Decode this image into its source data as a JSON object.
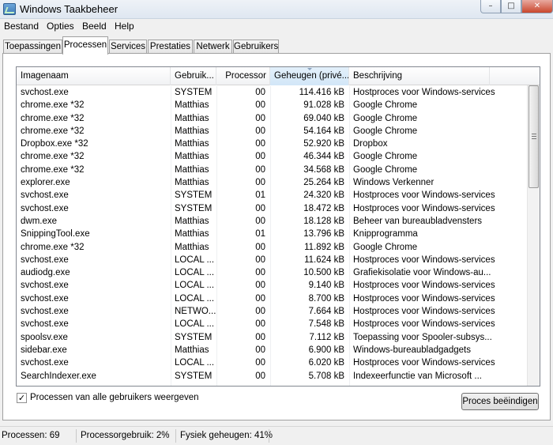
{
  "window": {
    "title": "Windows Taakbeheer"
  },
  "menu": [
    "Bestand",
    "Opties",
    "Beeld",
    "Help"
  ],
  "tabs": [
    "Toepassingen",
    "Processen",
    "Services",
    "Prestaties",
    "Netwerk",
    "Gebruikers"
  ],
  "active_tab": "Processen",
  "columns": {
    "name": "Imagenaam",
    "user": "Gebruik...",
    "cpu": "Processor",
    "mem": "Geheugen (privé...",
    "desc": "Beschrijving"
  },
  "sorted_column": "mem",
  "processes": [
    {
      "name": "svchost.exe",
      "user": "SYSTEM",
      "cpu": "00",
      "mem": "114.416 kB",
      "desc": "Hostproces voor Windows-services"
    },
    {
      "name": "chrome.exe *32",
      "user": "Matthias",
      "cpu": "00",
      "mem": "91.028 kB",
      "desc": "Google Chrome"
    },
    {
      "name": "chrome.exe *32",
      "user": "Matthias",
      "cpu": "00",
      "mem": "69.040 kB",
      "desc": "Google Chrome"
    },
    {
      "name": "chrome.exe *32",
      "user": "Matthias",
      "cpu": "00",
      "mem": "54.164 kB",
      "desc": "Google Chrome"
    },
    {
      "name": "Dropbox.exe *32",
      "user": "Matthias",
      "cpu": "00",
      "mem": "52.920 kB",
      "desc": "Dropbox"
    },
    {
      "name": "chrome.exe *32",
      "user": "Matthias",
      "cpu": "00",
      "mem": "46.344 kB",
      "desc": "Google Chrome"
    },
    {
      "name": "chrome.exe *32",
      "user": "Matthias",
      "cpu": "00",
      "mem": "34.568 kB",
      "desc": "Google Chrome"
    },
    {
      "name": "explorer.exe",
      "user": "Matthias",
      "cpu": "00",
      "mem": "25.264 kB",
      "desc": "Windows Verkenner"
    },
    {
      "name": "svchost.exe",
      "user": "SYSTEM",
      "cpu": "01",
      "mem": "24.320 kB",
      "desc": "Hostproces voor Windows-services"
    },
    {
      "name": "svchost.exe",
      "user": "SYSTEM",
      "cpu": "00",
      "mem": "18.472 kB",
      "desc": "Hostproces voor Windows-services"
    },
    {
      "name": "dwm.exe",
      "user": "Matthias",
      "cpu": "00",
      "mem": "18.128 kB",
      "desc": "Beheer van bureaubladvensters"
    },
    {
      "name": "SnippingTool.exe",
      "user": "Matthias",
      "cpu": "01",
      "mem": "13.796 kB",
      "desc": "Knipprogramma"
    },
    {
      "name": "chrome.exe *32",
      "user": "Matthias",
      "cpu": "00",
      "mem": "11.892 kB",
      "desc": "Google Chrome"
    },
    {
      "name": "svchost.exe",
      "user": "LOCAL ...",
      "cpu": "00",
      "mem": "11.624 kB",
      "desc": "Hostproces voor Windows-services"
    },
    {
      "name": "audiodg.exe",
      "user": "LOCAL ...",
      "cpu": "00",
      "mem": "10.500 kB",
      "desc": "Grafiekisolatie voor Windows-au..."
    },
    {
      "name": "svchost.exe",
      "user": "LOCAL ...",
      "cpu": "00",
      "mem": "9.140 kB",
      "desc": "Hostproces voor Windows-services"
    },
    {
      "name": "svchost.exe",
      "user": "LOCAL ...",
      "cpu": "00",
      "mem": "8.700 kB",
      "desc": "Hostproces voor Windows-services"
    },
    {
      "name": "svchost.exe",
      "user": "NETWO...",
      "cpu": "00",
      "mem": "7.664 kB",
      "desc": "Hostproces voor Windows-services"
    },
    {
      "name": "svchost.exe",
      "user": "LOCAL ...",
      "cpu": "00",
      "mem": "7.548 kB",
      "desc": "Hostproces voor Windows-services"
    },
    {
      "name": "spoolsv.exe",
      "user": "SYSTEM",
      "cpu": "00",
      "mem": "7.112 kB",
      "desc": "Toepassing voor Spooler-subsys..."
    },
    {
      "name": "sidebar.exe",
      "user": "Matthias",
      "cpu": "00",
      "mem": "6.900 kB",
      "desc": "Windows-bureaubladgadgets"
    },
    {
      "name": "svchost.exe",
      "user": "LOCAL ...",
      "cpu": "00",
      "mem": "6.020 kB",
      "desc": "Hostproces voor Windows-services"
    },
    {
      "name": "SearchIndexer.exe",
      "user": "SYSTEM",
      "cpu": "00",
      "mem": "5.708 kB",
      "desc": "Indexeerfunctie van Microsoft ..."
    }
  ],
  "show_all_users": {
    "label": "Processen van alle gebruikers weergeven",
    "checked": true,
    "check_glyph": "✓"
  },
  "end_process_button": "Proces beëindigen",
  "status": {
    "processes": "Processen: 69",
    "cpu": "Processorgebruik: 2%",
    "memory": "Fysiek geheugen: 41%"
  },
  "window_buttons": {
    "minimize": "–",
    "maximize": "□",
    "close": "✕"
  }
}
